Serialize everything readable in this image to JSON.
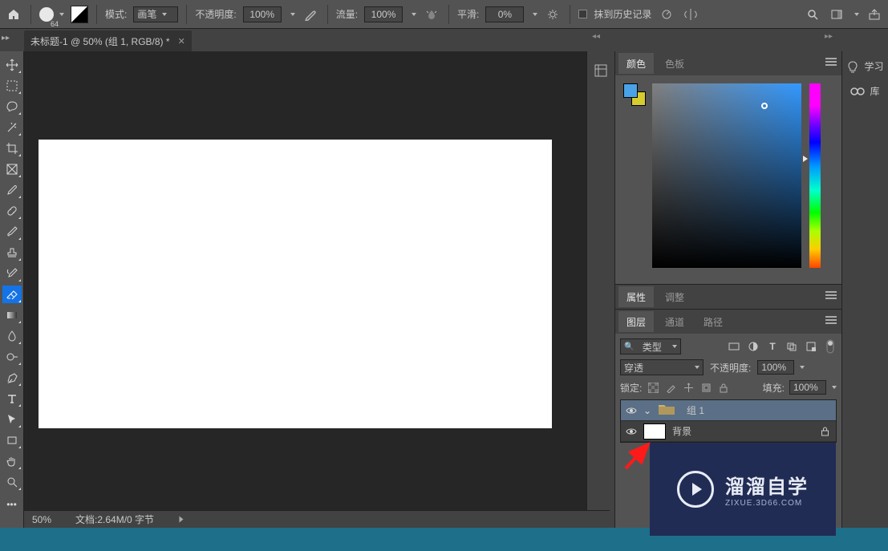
{
  "optbar": {
    "brush_size": "64",
    "mode_label": "模式:",
    "mode_value": "画笔",
    "opacity_label": "不透明度:",
    "opacity_value": "100%",
    "flow_label": "流量:",
    "flow_value": "100%",
    "smoothing_label": "平滑:",
    "smoothing_value": "0%",
    "history_checkbox_label": "抹到历史记录"
  },
  "doc_tab": {
    "title": "未标题-1 @ 50% (组 1, RGB/8) *"
  },
  "panels": {
    "color_tab": "颜色",
    "swatches_tab": "色板",
    "attributes_tab": "属性",
    "adjust_tab": "调整",
    "layers_tab": "图层",
    "channels_tab": "通道",
    "paths_tab": "路径"
  },
  "layer_panel": {
    "filter_label": "类型",
    "blend_value": "穿透",
    "opacity_label": "不透明度:",
    "opacity_value": "100%",
    "lock_label": "锁定:",
    "fill_label": "填充:",
    "fill_value": "100%",
    "layers": [
      {
        "name": "组 1",
        "is_group": true,
        "selected": true
      },
      {
        "name": "背景",
        "is_group": false,
        "locked": true
      }
    ]
  },
  "right_dock": {
    "learn_label": "学习",
    "library_label": "库"
  },
  "status": {
    "zoom": "50%",
    "doc_info": "文档:2.64M/0 字节"
  },
  "watermark": {
    "big": "溜溜自学",
    "small": "ZIXUE.3D66.COM"
  },
  "colors": {
    "foreground": "#4aa3e8",
    "background": "#d6cb2f"
  }
}
